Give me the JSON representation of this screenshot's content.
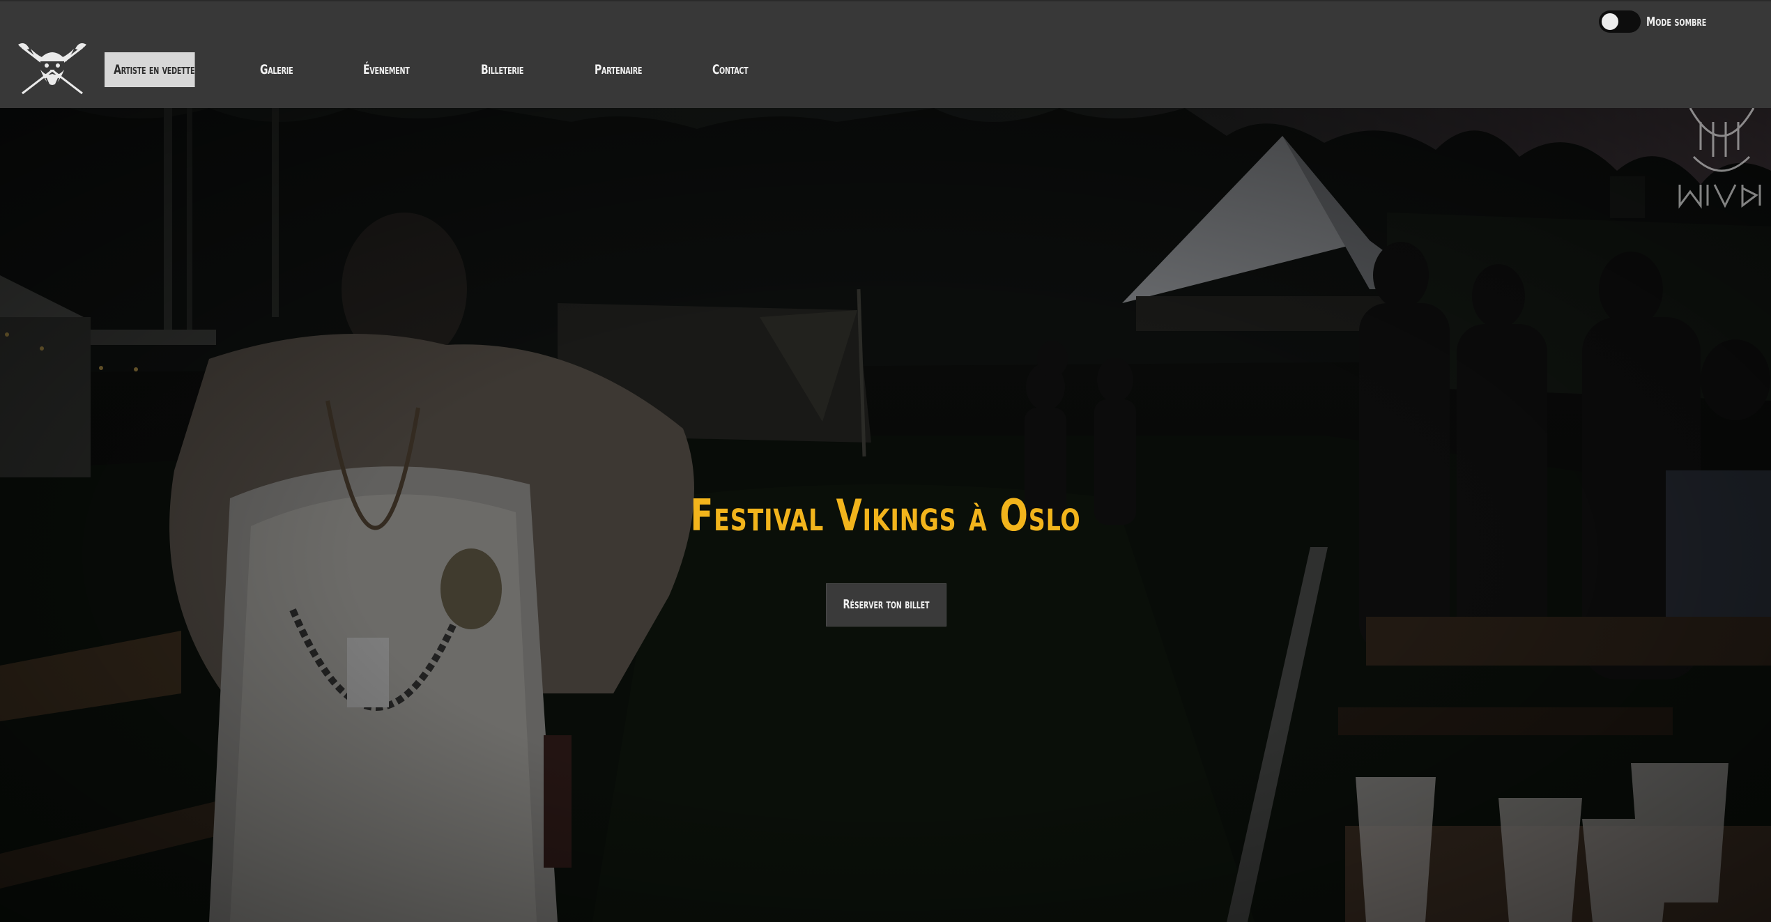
{
  "header": {
    "logo_icon": "viking-skull-axes-icon",
    "nav": [
      {
        "label": "Artiste en vedette",
        "active": true
      },
      {
        "label": "Galerie",
        "active": false
      },
      {
        "label": "Évenement",
        "active": false
      },
      {
        "label": "Billeterie",
        "active": false
      },
      {
        "label": "Partenaire",
        "active": false
      },
      {
        "label": "Contact",
        "active": false
      }
    ],
    "dark_mode": {
      "label": "Mode sombre",
      "enabled": false
    }
  },
  "hero": {
    "title": "Festival Vikings à Oslo",
    "cta_label": "Réserver ton billet",
    "background_icon": "festival-night-photo",
    "watermark_icon": "viking-helmet-rune-watermark"
  },
  "colors": {
    "header_bg": "#383838",
    "active_nav_bg": "#d7d7d7",
    "title_gold": "#f2b41c",
    "cta_bg": "#3a3a3a"
  }
}
